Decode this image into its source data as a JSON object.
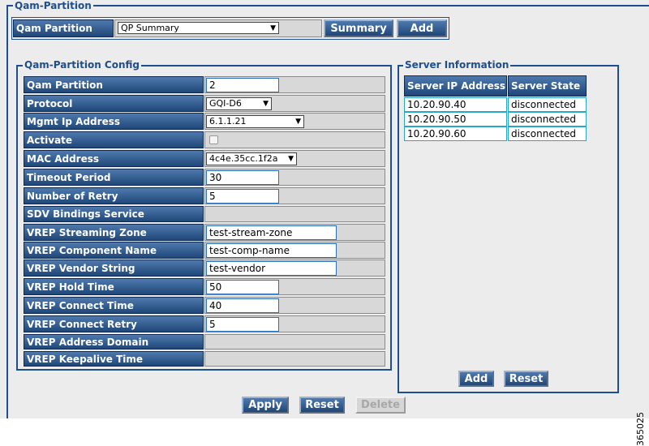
{
  "top": {
    "legend": "Qam-Partition",
    "label": "Qam Partition",
    "select_value": "QP Summary",
    "summary_button": "Summary",
    "add_button": "Add"
  },
  "config": {
    "legend": "Qam-Partition Config",
    "rows": [
      {
        "label": "Qam Partition",
        "type": "input",
        "value": "2"
      },
      {
        "label": "Protocol",
        "type": "select",
        "value": "GQI-D6"
      },
      {
        "label": "Mgmt Ip Address",
        "type": "select",
        "value": "6.1.1.21"
      },
      {
        "label": "Activate",
        "type": "checkbox",
        "value": ""
      },
      {
        "label": "MAC Address",
        "type": "select",
        "value": "4c4e.35cc.1f2a"
      },
      {
        "label": "Timeout Period",
        "type": "input",
        "value": "30"
      },
      {
        "label": "Number of Retry",
        "type": "input",
        "value": "5"
      },
      {
        "label": "SDV Bindings Service",
        "type": "empty",
        "value": ""
      },
      {
        "label": "VREP Streaming Zone",
        "type": "input",
        "value": "test-stream-zone"
      },
      {
        "label": "VREP Component Name",
        "type": "input",
        "value": "test-comp-name"
      },
      {
        "label": "VREP Vendor String",
        "type": "input",
        "value": "test-vendor"
      },
      {
        "label": "VREP Hold Time",
        "type": "input",
        "value": "50"
      },
      {
        "label": "VREP Connect Time",
        "type": "input",
        "value": "40"
      },
      {
        "label": "VREP Connect Retry",
        "type": "input",
        "value": "5"
      },
      {
        "label": "VREP Address Domain",
        "type": "empty",
        "value": ""
      },
      {
        "label": "VREP Keepalive Time",
        "type": "empty",
        "value": ""
      }
    ]
  },
  "server": {
    "legend": "Server Information",
    "col_ip": "Server IP Address",
    "col_state": "Server State",
    "rows": [
      {
        "ip": "10.20.90.40",
        "state": "disconnected"
      },
      {
        "ip": "10.20.90.50",
        "state": "disconnected"
      },
      {
        "ip": "10.20.90.60",
        "state": "disconnected"
      }
    ],
    "add_button": "Add",
    "reset_button": "Reset"
  },
  "footer": {
    "apply_button": "Apply",
    "reset_button": "Reset",
    "delete_button": "Delete"
  },
  "side_number": "365025"
}
